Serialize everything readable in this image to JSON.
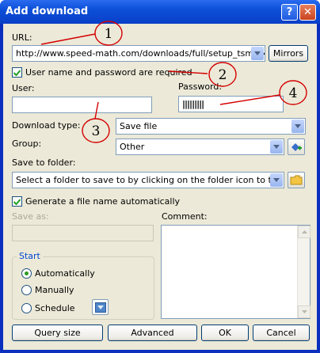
{
  "window": {
    "title": "Add download",
    "help_glyph": "?",
    "close_glyph": "✕"
  },
  "url": {
    "label": "URL:",
    "value": "http://www.speed-math.com/downloads/full/setup_tsm.exe",
    "mirrors_label": "Mirrors"
  },
  "auth": {
    "checkbox_label": "User name and password are required",
    "checked": true,
    "user_label": "User:",
    "user_value": "",
    "password_label": "Password:",
    "password_value": "|||||||||"
  },
  "download_type": {
    "label": "Download type:",
    "value": "Save file"
  },
  "group": {
    "label": "Group:",
    "value": "Other"
  },
  "save_to": {
    "label": "Save to folder:",
    "value": "Select a folder to save to by clicking on the folder icon to the right"
  },
  "generate": {
    "label": "Generate a file name automatically",
    "checked": true
  },
  "save_as": {
    "label": "Save as:",
    "value": ""
  },
  "comment": {
    "label": "Comment:",
    "value": ""
  },
  "start": {
    "title": "Start",
    "options": [
      "Automatically",
      "Manually",
      "Schedule"
    ],
    "selected": "Automatically"
  },
  "buttons": {
    "query_size": "Query size",
    "advanced": "Advanced",
    "ok": "OK",
    "cancel": "Cancel"
  },
  "callouts": [
    "1",
    "2",
    "3",
    "4"
  ],
  "colors": {
    "titlebar": "#0a3fc7",
    "face": "#ece9d8",
    "annotation": "#d40000",
    "radio_dot": "#2b9a1f"
  }
}
